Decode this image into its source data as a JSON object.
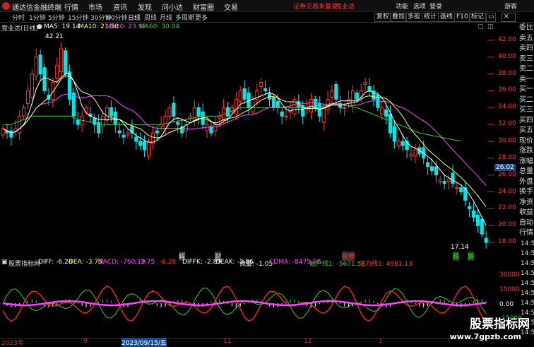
{
  "titlebar": {
    "app_name": "通达信金融终端",
    "menus": [
      "行情",
      "市场",
      "资讯",
      "发现",
      "问小达",
      "财富圈",
      "交易"
    ],
    "notice1": "证券交易未登录",
    "notice2": "竞业达",
    "right_buttons": [
      "功能",
      "选项",
      "登录",
      "游客"
    ]
  },
  "periods": [
    "分时",
    "1分钟",
    "5分钟",
    "15分钟",
    "30分钟",
    "60分钟",
    "日线",
    "周线",
    "月线",
    "多周期",
    "更多"
  ],
  "active_period": "日线",
  "toolbar": [
    "复权",
    "叠加",
    "多股",
    "统计",
    "画线",
    "F10",
    "标记"
  ],
  "stock": {
    "name": "竞业达(日线)",
    "ma5": "MA5: 19.14",
    "ma10": "MA10: 21.58",
    "ma20": "MA20: 23.92",
    "ma60": "MA60: 30.04",
    "high_label": "42.21",
    "low_label": "17.14",
    "price_tag": "26.02"
  },
  "y_axis": [
    "42.00",
    "40.00",
    "38.00",
    "36.00",
    "34.00",
    "32.00",
    "30.00",
    "28.00",
    "26.00",
    "24.00",
    "22.00",
    "20.00",
    "18.00"
  ],
  "event_markers": [
    "解",
    "财",
    "涨停",
    "跌",
    "跌"
  ],
  "indicator": {
    "name": "股票指标网",
    "diff": "DIFF: -6.28",
    "dea": "DEA: -3.75",
    "macd": "MACD: -760.19",
    "v1": ": -3.75",
    "v2": "-6.28",
    "diffk": "DIFFK: -2.89",
    "deak": "DEAK: -2.86",
    "flow": "流量: -1.05",
    "cdma": "CDMA: -8475.98",
    "sanhu": "散户线1: -5671.58",
    "zhuli": "主力线1: 4981.13",
    "y_axis": [
      "30000",
      "15000",
      "0.00",
      "-15000"
    ]
  },
  "x_axis": [
    "2023年",
    "9",
    "2023/09/15/五",
    "11",
    "12",
    "1"
  ],
  "right_panel": [
    "委比",
    "卖五",
    "卖四",
    "卖三",
    "卖二",
    "卖一",
    "买一",
    "买二",
    "买三",
    "买四",
    "买五",
    "现价",
    "涨跌",
    "涨幅",
    "总量",
    "外盘",
    "换手",
    "净资",
    "收益",
    "自动",
    "行情"
  ],
  "right_times": [
    "14:50",
    "14:50",
    "14:50",
    "14:50",
    "14:50",
    "14:50",
    "14:50",
    "14:50",
    "14:50",
    "14:50"
  ],
  "watermark": {
    "line1": "股票指标网",
    "line2": "www.7gpzb.com"
  },
  "colors": {
    "up": "#ff3333",
    "down": "#00e5e5",
    "ma5": "#ffffff",
    "ma10": "#ffff66",
    "ma20": "#ff44ff",
    "ma60": "#33cc33",
    "bg": "#000000"
  },
  "chart_data": {
    "type": "candlestick",
    "ylim": [
      17,
      43
    ],
    "closes": [
      31.5,
      31,
      30.5,
      31.5,
      33,
      34,
      36,
      38,
      40,
      38,
      36,
      35,
      37,
      39,
      41,
      38,
      35,
      33,
      32,
      33,
      34,
      33,
      32,
      31,
      33,
      34,
      33,
      32,
      31,
      30.5,
      31,
      31,
      30,
      29.5,
      29,
      30,
      31,
      31,
      32,
      33,
      34,
      33,
      32,
      31,
      32,
      33,
      34,
      33,
      32,
      32,
      31,
      32,
      33,
      34,
      33,
      34,
      35,
      36,
      35,
      34,
      35,
      36,
      37,
      36,
      35,
      34,
      34,
      33,
      33,
      34,
      35,
      34,
      33,
      34,
      35,
      34,
      33,
      34,
      35,
      36,
      35,
      34,
      34,
      35,
      36,
      35,
      36,
      37,
      36,
      35,
      34,
      34,
      33,
      31,
      30,
      30,
      29.5,
      29,
      28.5,
      29,
      28.5,
      28,
      27,
      26.5,
      26,
      25.5,
      25,
      25.5,
      25,
      24.5,
      24,
      23,
      22,
      21,
      20,
      19,
      18
    ],
    "ma60": [
      32,
      32,
      32,
      32.2,
      32.4,
      32.6,
      32.8,
      33,
      33,
      33,
      33,
      33,
      33,
      33,
      33,
      33,
      33,
      32.8,
      32.6,
      32.5,
      32.4,
      32.3,
      32.2,
      32.1,
      32,
      32,
      32,
      32,
      32,
      32,
      32,
      32,
      32,
      32,
      32,
      32,
      32,
      32,
      32,
      32.1,
      32.2,
      32.3,
      32.4,
      32.5,
      32.6,
      32.7,
      32.8,
      32.9,
      33,
      33,
      33,
      33,
      33,
      33.2,
      33.4,
      33.6,
      33.8,
      34,
      34,
      34,
      34,
      34,
      34,
      34,
      34,
      34,
      34,
      34,
      34,
      34,
      34,
      34,
      34,
      34,
      34,
      34,
      34.1,
      34.2,
      34.3,
      34.4,
      34.4,
      34.4,
      34.3,
      34.2,
      34.1,
      34,
      33.8,
      33.6,
      33.4,
      33.2,
      33,
      32.8,
      32.6,
      32.4,
      32.2,
      32,
      31.8,
      31.6,
      31.4,
      31.2,
      31,
      30.9,
      30.8,
      30.7,
      30.6,
      30.5,
      30.4,
      30.3,
      30.2,
      30.1,
      30.04
    ]
  }
}
